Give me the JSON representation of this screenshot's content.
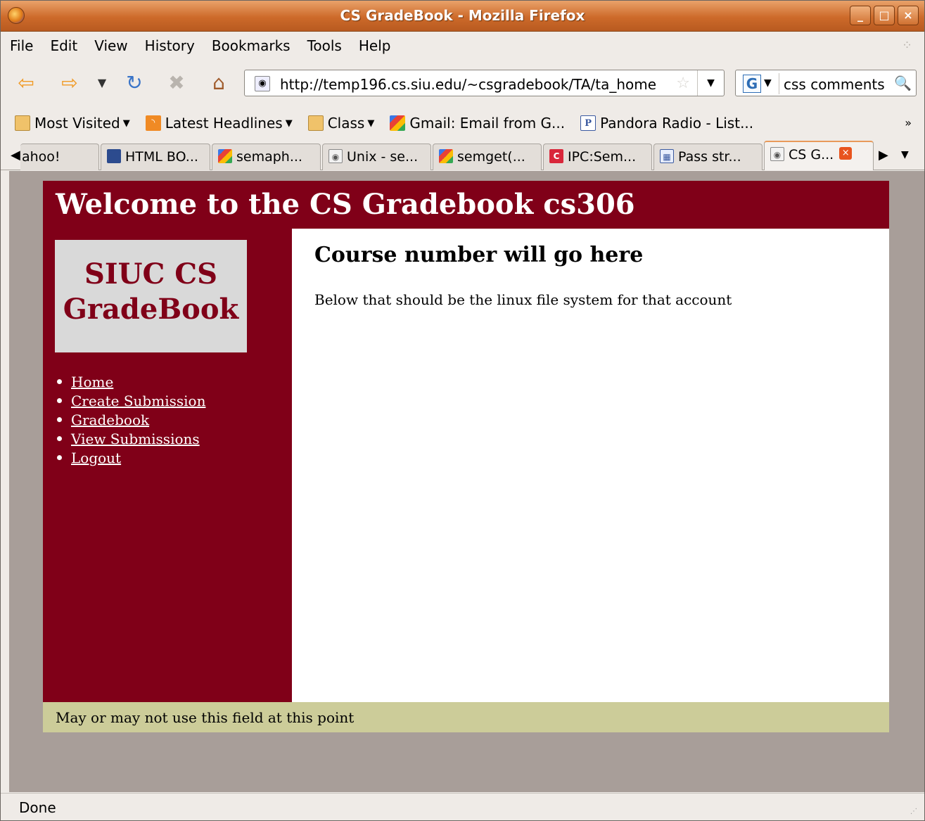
{
  "window": {
    "title": "CS GradeBook - Mozilla Firefox"
  },
  "menubar": {
    "items": [
      "File",
      "Edit",
      "View",
      "History",
      "Bookmarks",
      "Tools",
      "Help"
    ]
  },
  "navbar": {
    "url": "http://temp196.cs.siu.edu/~csgradebook/TA/ta_home",
    "search_query": "css comments",
    "search_engine": "G"
  },
  "bookmarks": {
    "items": [
      {
        "label": "Most Visited",
        "icon": "folder-icon",
        "dropdown": true
      },
      {
        "label": "Latest Headlines",
        "icon": "rss-icon",
        "dropdown": true
      },
      {
        "label": "Class",
        "icon": "folder-icon",
        "dropdown": true
      },
      {
        "label": "Gmail: Email from G...",
        "icon": "google-icon",
        "dropdown": false
      },
      {
        "label": "Pandora Radio - List...",
        "icon": "pandora-icon",
        "dropdown": false
      }
    ],
    "more": "»"
  },
  "tabs": [
    {
      "label": "ahoo!",
      "icon": "none"
    },
    {
      "label": "HTML BO...",
      "icon": "person-icon"
    },
    {
      "label": "semaph...",
      "icon": "google-icon"
    },
    {
      "label": "Unix - se...",
      "icon": "page-icon"
    },
    {
      "label": "semget(...",
      "icon": "google-icon"
    },
    {
      "label": "IPC:Sem...",
      "icon": "c-icon"
    },
    {
      "label": "Pass str...",
      "icon": "grid-icon"
    },
    {
      "label": "CS G...",
      "icon": "page-icon",
      "active": true
    }
  ],
  "page": {
    "header": "Welcome to the CS Gradebook cs306",
    "logo_line1": "SIUC CS",
    "logo_line2": "GradeBook",
    "nav": [
      "Home",
      "Create Submission",
      "Gradebook",
      "View Submissions",
      "Logout"
    ],
    "heading": "Course number will go here",
    "body_text": "Below that should be the linux file system for that account",
    "footer": "May or may not use this field at this point"
  },
  "status": {
    "text": "Done"
  },
  "colors": {
    "header": "#800018",
    "footer": "#cccc99",
    "viewport": "#a89e99",
    "title_bar": "#cd6a2a"
  }
}
